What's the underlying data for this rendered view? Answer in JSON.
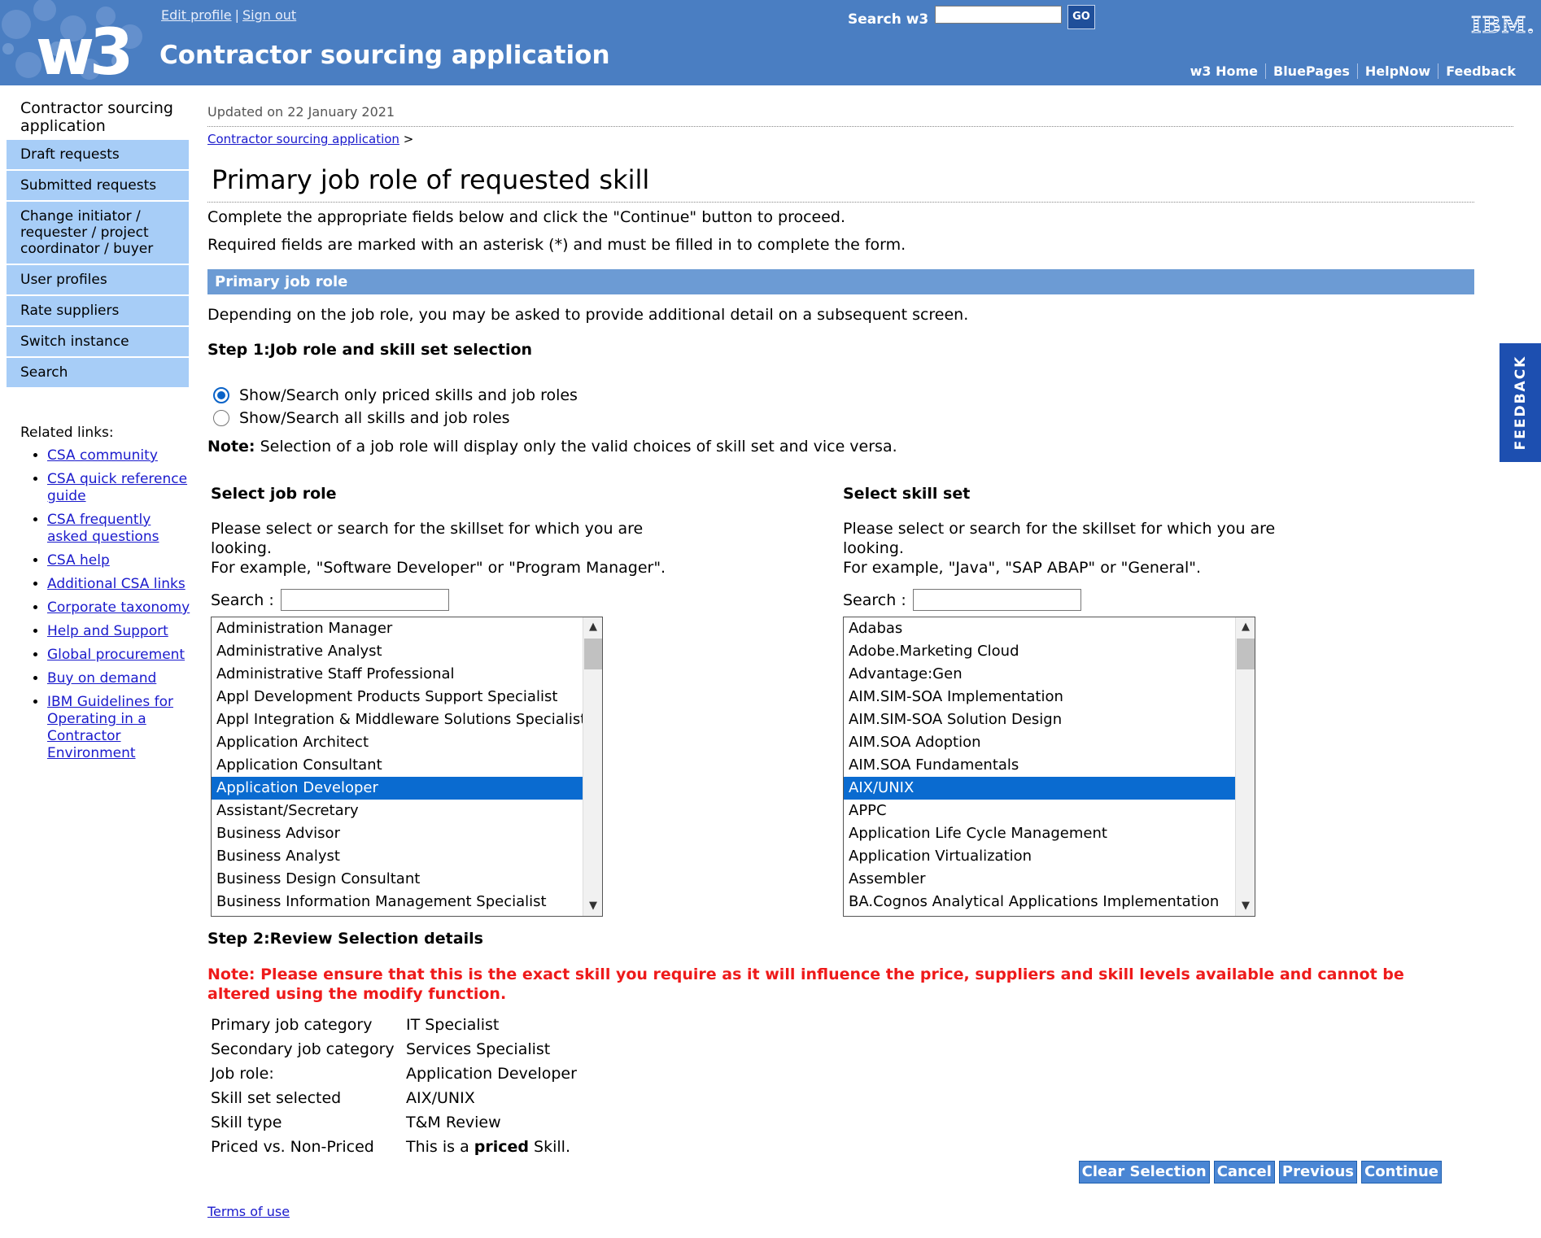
{
  "masthead": {
    "logo_text": "w3",
    "app_title": "Contractor sourcing application",
    "edit_profile": "Edit profile",
    "separator": "|",
    "sign_out": "Sign out",
    "search_label": "Search w3",
    "search_value": "",
    "go_label": "GO",
    "ibm_logo": "IBM.",
    "util_links": [
      "w3 Home",
      "BluePages",
      "HelpNow",
      "Feedback"
    ],
    "brand_color": "#4a7ec2"
  },
  "sidebar": {
    "title": "Contractor sourcing application",
    "items": [
      "Draft requests",
      "Submitted requests",
      "Change initiator / requester / project coordinator / buyer",
      "User profiles",
      "Rate suppliers",
      "Switch instance",
      "Search"
    ],
    "related_title": "Related links:",
    "related_links": [
      "CSA community",
      "CSA quick reference guide",
      "CSA frequently asked questions",
      "CSA help",
      "Additional CSA links",
      "Corporate taxonomy",
      "Help and Support",
      "Global procurement",
      "Buy on demand",
      "IBM Guidelines for Operating in a Contractor Environment"
    ]
  },
  "main": {
    "updated": "Updated on 22 January 2021",
    "breadcrumb_link": "Contractor sourcing application",
    "breadcrumb_sep": ">",
    "page_title": "Primary job role of requested skill",
    "intro1": "Complete the appropriate fields below and click the \"Continue\" button to proceed.",
    "intro2": "Required fields are marked with an asterisk (*) and must be filled in to complete the form.",
    "section_title": "Primary job role",
    "section_desc": "Depending on the job role, you may be asked to provide additional detail on a subsequent screen.",
    "step1": "Step 1:Job role and skill set selection",
    "radio_priced": "Show/Search only priced skills and job roles",
    "radio_all": "Show/Search all skills and job roles",
    "note_label": "Note:",
    "note_text": " Selection of a job role will display only the valid choices of skill set and vice versa.",
    "job_role": {
      "heading": "Select job role",
      "desc1": "Please select or search for the skillset for which you are looking.",
      "desc2": "For example, \"Software Developer\" or \"Program Manager\".",
      "search_label": "Search :",
      "options": [
        "Administration Manager",
        "Administrative Analyst",
        "Administrative Staff Professional",
        "Appl Development Products Support Specialist",
        "Appl Integration & Middleware Solutions Specialist",
        "Application Architect",
        "Application Consultant",
        "Application Developer",
        "Assistant/Secretary",
        "Business Advisor",
        "Business Analyst",
        "Business Design Consultant",
        "Business Information Management Specialist"
      ],
      "selected": "Application Developer"
    },
    "skill_set": {
      "heading": "Select skill set",
      "desc1": "Please select or search for the skillset for which you are looking.",
      "desc2": "For example, \"Java\", \"SAP ABAP\" or \"General\".",
      "search_label": "Search :",
      "options": [
        "Adabas",
        "Adobe.Marketing Cloud",
        "Advantage:Gen",
        "AIM.SIM-SOA Implementation",
        "AIM.SIM-SOA Solution Design",
        "AIM.SOA Adoption",
        "AIM.SOA Fundamentals",
        "AIX/UNIX",
        "APPC",
        "Application Life Cycle Management",
        "Application Virtualization",
        "Assembler",
        "BA.Cognos Analytical Applications Implementation"
      ],
      "selected": "AIX/UNIX"
    },
    "step2": "Step 2:Review Selection details",
    "warning": "Note: Please ensure that this is the exact skill you require as it will influence the price, suppliers and skill levels available and cannot be altered using the modify function.",
    "summary": {
      "primary_category_label": "Primary job category",
      "primary_category_value": "IT Specialist",
      "secondary_category_label": "Secondary job category",
      "secondary_category_value": "Services Specialist",
      "job_role_label": "Job role:",
      "job_role_value": "Application Developer",
      "skill_set_label": "Skill set selected",
      "skill_set_value": "AIX/UNIX",
      "skill_type_label": "Skill type",
      "skill_type_value": "T&M Review",
      "priced_label": "Priced vs. Non-Priced",
      "priced_prefix": "This is a ",
      "priced_bold": "priced",
      "priced_suffix": " Skill."
    },
    "buttons": {
      "clear": "Clear Selection",
      "cancel": "Cancel",
      "previous": "Previous",
      "continue": "Continue"
    },
    "terms": "Terms of use"
  },
  "feedback_tab": "FEEDBACK",
  "colors": {
    "nav_item_bg": "#a7cdf7",
    "section_bar": "#6c9bd4",
    "selection": "#0a6bd0",
    "warning": "#ee1a1a",
    "feedback_tab": "#1d4fb0"
  }
}
